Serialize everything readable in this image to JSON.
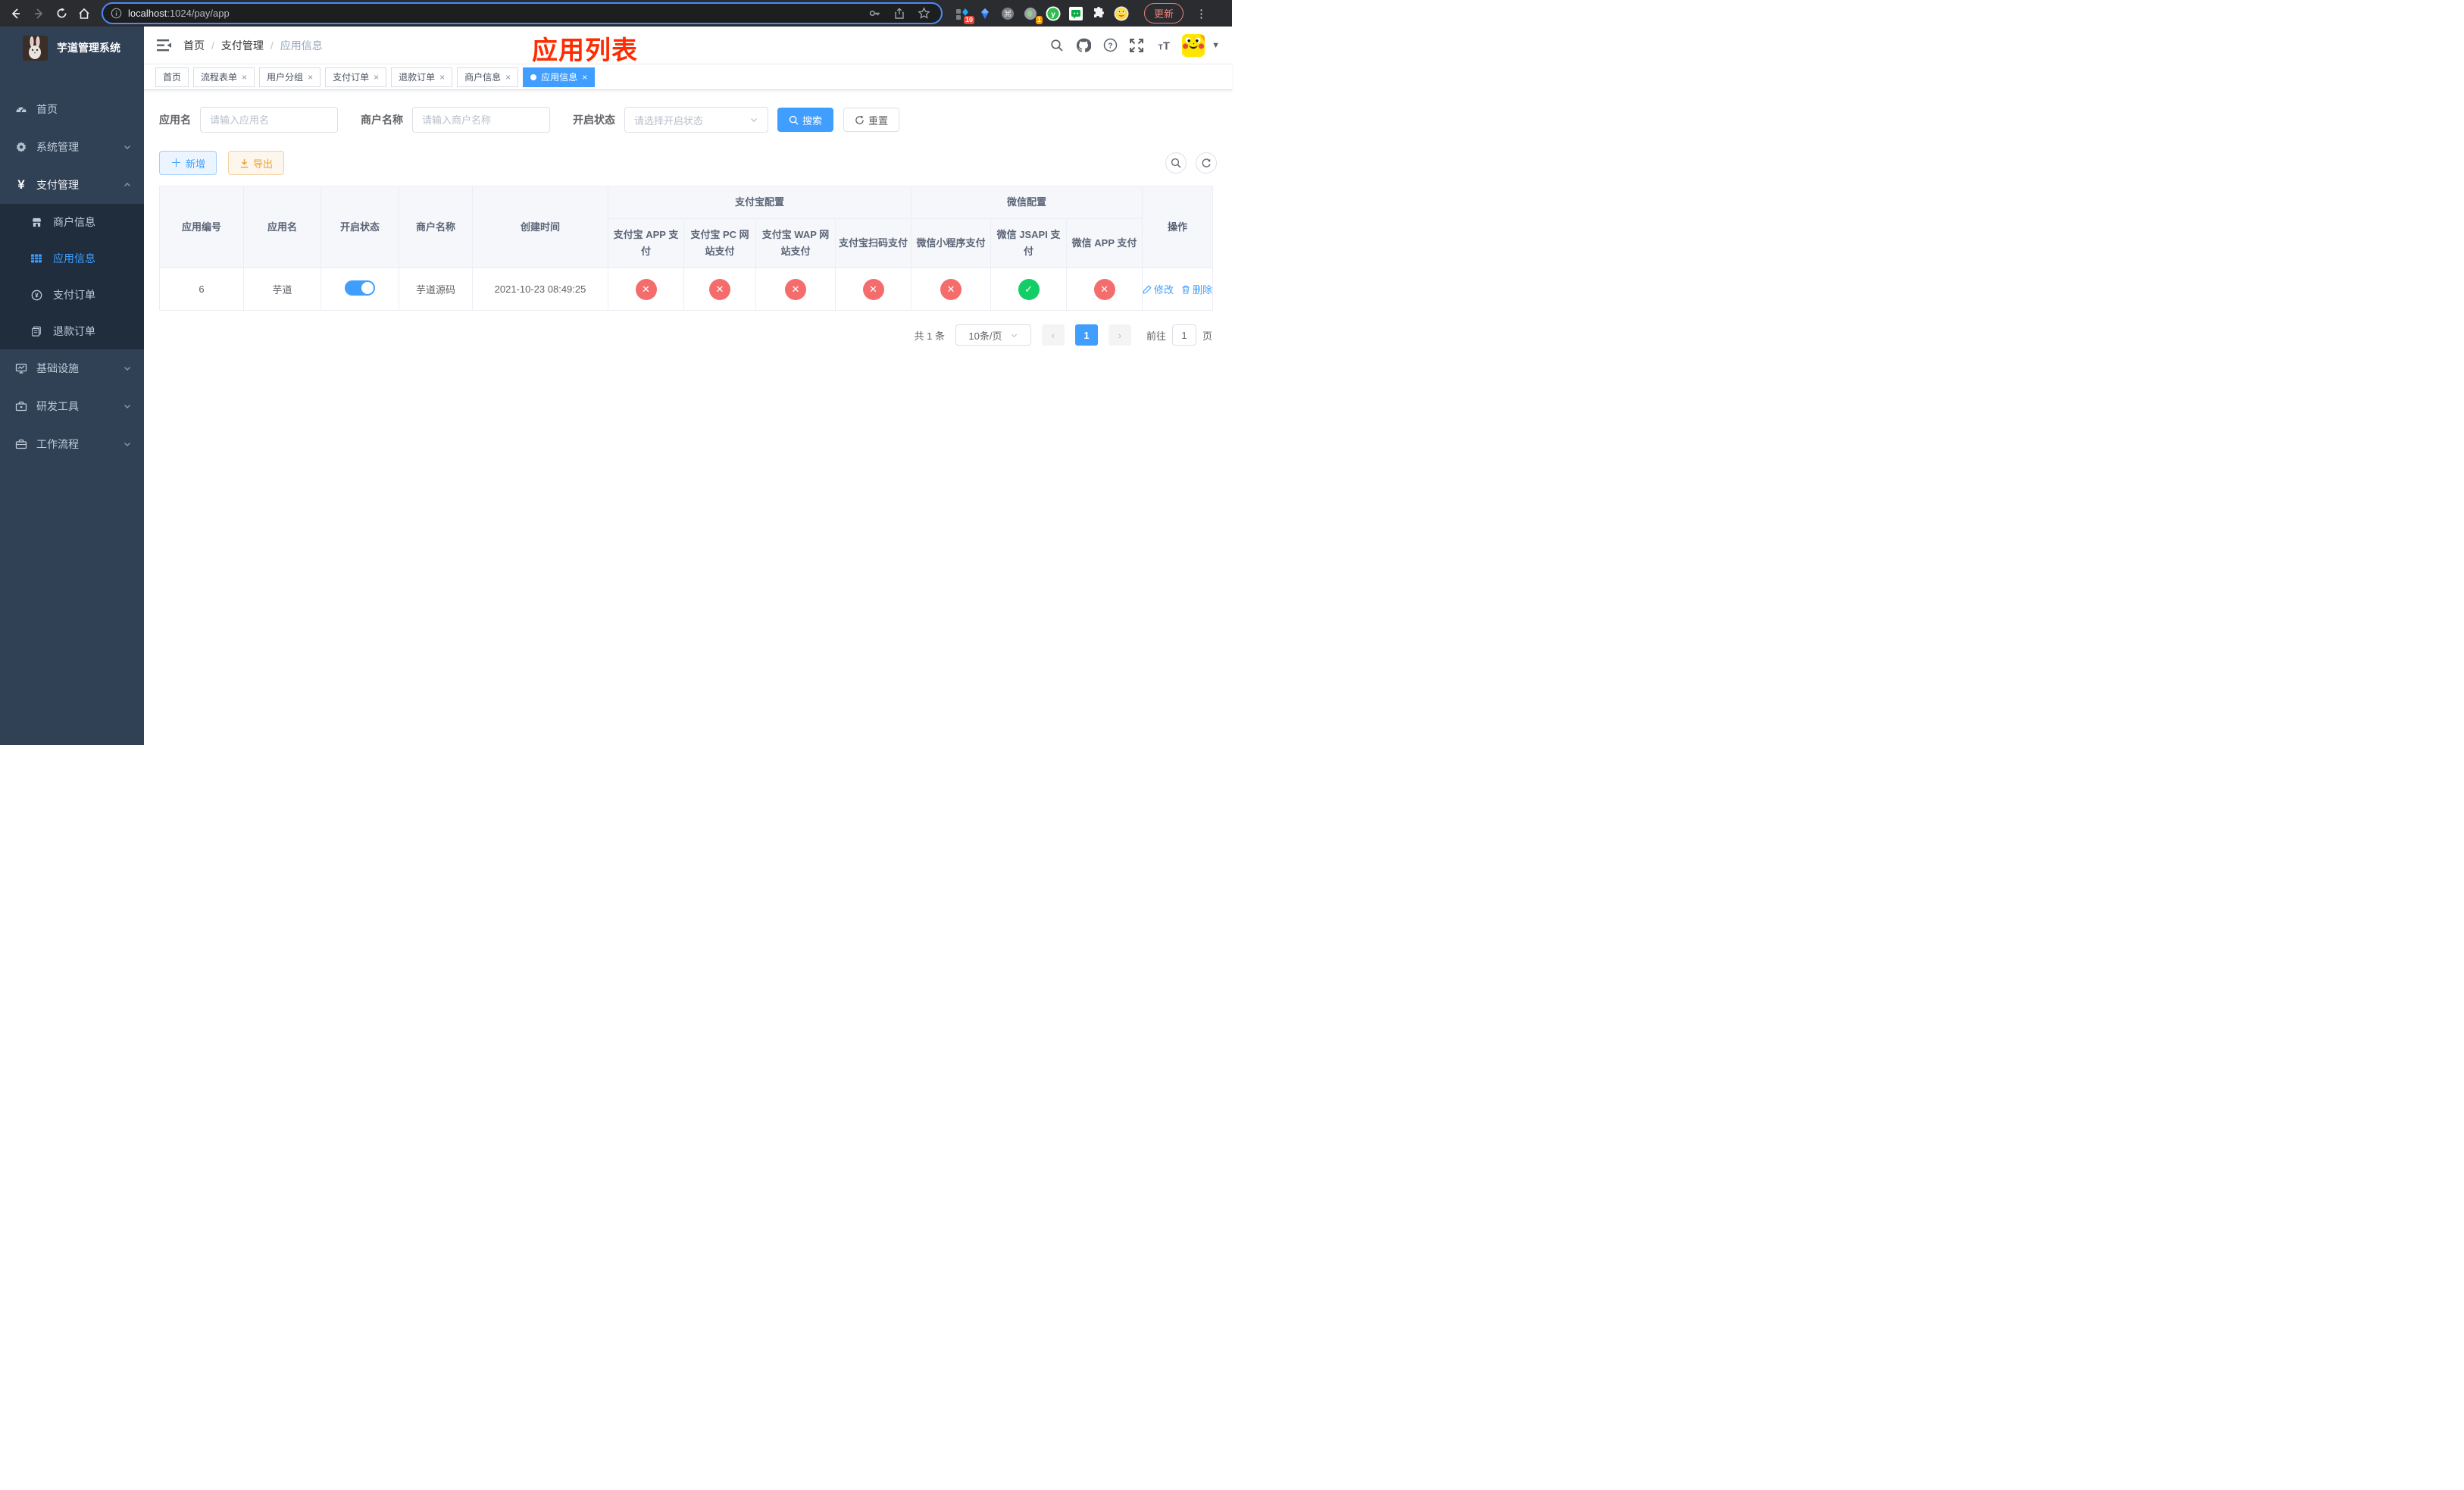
{
  "browser": {
    "url_host": "localhost",
    "url_rest": ":1024/pay/app",
    "update_label": "更新",
    "ext_badge_10": "10",
    "ext_badge_1": "1"
  },
  "sidebar": {
    "title": "芋道管理系统",
    "items": [
      {
        "label": "首页"
      },
      {
        "label": "系统管理"
      },
      {
        "label": "支付管理"
      },
      {
        "label": "商户信息"
      },
      {
        "label": "应用信息"
      },
      {
        "label": "支付订单"
      },
      {
        "label": "退款订单"
      },
      {
        "label": "基础设施"
      },
      {
        "label": "研发工具"
      },
      {
        "label": "工作流程"
      }
    ]
  },
  "navbar": {
    "breadcrumb": [
      "首页",
      "支付管理",
      "应用信息"
    ],
    "overlay_title": "应用列表"
  },
  "tabs": [
    {
      "label": "首页"
    },
    {
      "label": "流程表单"
    },
    {
      "label": "用户分组"
    },
    {
      "label": "支付订单"
    },
    {
      "label": "退款订单"
    },
    {
      "label": "商户信息"
    },
    {
      "label": "应用信息"
    }
  ],
  "filters": {
    "app_name_label": "应用名",
    "app_name_placeholder": "请输入应用名",
    "merchant_label": "商户名称",
    "merchant_placeholder": "请输入商户名称",
    "status_label": "开启状态",
    "status_placeholder": "请选择开启状态",
    "search_label": "搜索",
    "reset_label": "重置"
  },
  "toolbar": {
    "add_label": "新增",
    "export_label": "导出"
  },
  "table": {
    "col_headers": [
      "应用编号",
      "应用名",
      "开启状态",
      "商户名称",
      "创建时间"
    ],
    "group_alipay": "支付宝配置",
    "group_wechat": "微信配置",
    "alipay_sub": [
      "支付宝 APP 支付",
      "支付宝 PC 网站支付",
      "支付宝 WAP 网站支付",
      "支付宝扫码支付"
    ],
    "wechat_sub": [
      "微信小程序支付",
      "微信 JSAPI 支付",
      "微信 APP 支付"
    ],
    "action_header": "操作",
    "row": {
      "id": "6",
      "name": "芋道",
      "enabled": true,
      "merchant": "芋道源码",
      "created": "2021-10-23 08:49:25",
      "alipay_app": false,
      "alipay_pc": false,
      "alipay_wap": false,
      "alipay_qr": false,
      "wechat_lite": false,
      "wechat_jsapi": true,
      "wechat_app": false,
      "edit_label": "修改",
      "delete_label": "删除"
    }
  },
  "pagination": {
    "total_text": "共 1 条",
    "page_size": "10条/页",
    "current_page": "1",
    "goto_label": "前往",
    "goto_value": "1",
    "page_suffix": "页"
  }
}
